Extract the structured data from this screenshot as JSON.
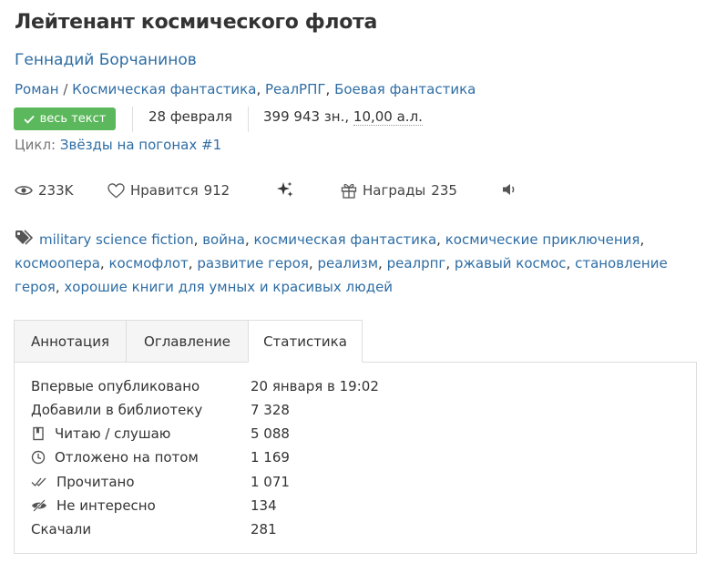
{
  "book": {
    "title": "Лейтенант космического флота",
    "author": "Геннадий Борчанинов",
    "genres": [
      "Роман",
      "Космическая фантастика",
      "РеалРПГ",
      "Боевая фантастика"
    ],
    "genre_separator": "/",
    "status_badge": "весь текст",
    "date": "28 февраля",
    "size_chars": "399 943 зн.,",
    "size_sheets": "10,00 а.л.",
    "cycle_label": "Цикл:",
    "cycle_name": "Звёзды на погонах",
    "cycle_number": "#1"
  },
  "stats": {
    "views": "233K",
    "likes_label": "Нравится",
    "likes": "912",
    "awards_label": "Награды",
    "awards": "235"
  },
  "tags": [
    "military science fiction",
    "война",
    "космическая фантастика",
    "космические приключения",
    "космоопера",
    "космофлот",
    "развитие героя",
    "реализм",
    "реалрпг",
    "ржавый космос",
    "становление героя",
    "хорошие книги для умных и красивых людей"
  ],
  "tabs": [
    "Аннотация",
    "Оглавление",
    "Статистика"
  ],
  "active_tab": "Статистика",
  "statistics": [
    {
      "label": "Впервые опубликовано",
      "value": "20 января в 19:02",
      "icon": ""
    },
    {
      "label": "Добавили в библиотеку",
      "value": "7 328",
      "icon": ""
    },
    {
      "label": "Читаю / слушаю",
      "value": "5 088",
      "icon": "book-icon"
    },
    {
      "label": "Отложено на потом",
      "value": "1 169",
      "icon": "clock-icon"
    },
    {
      "label": "Прочитано",
      "value": "1 071",
      "icon": "double-check-icon"
    },
    {
      "label": "Не интересно",
      "value": "134",
      "icon": "eye-slash-icon"
    },
    {
      "label": "Скачали",
      "value": "281",
      "icon": ""
    }
  ],
  "colors": {
    "link": "#2e6da4",
    "badge": "#5cb85c",
    "border": "#dddddd"
  }
}
